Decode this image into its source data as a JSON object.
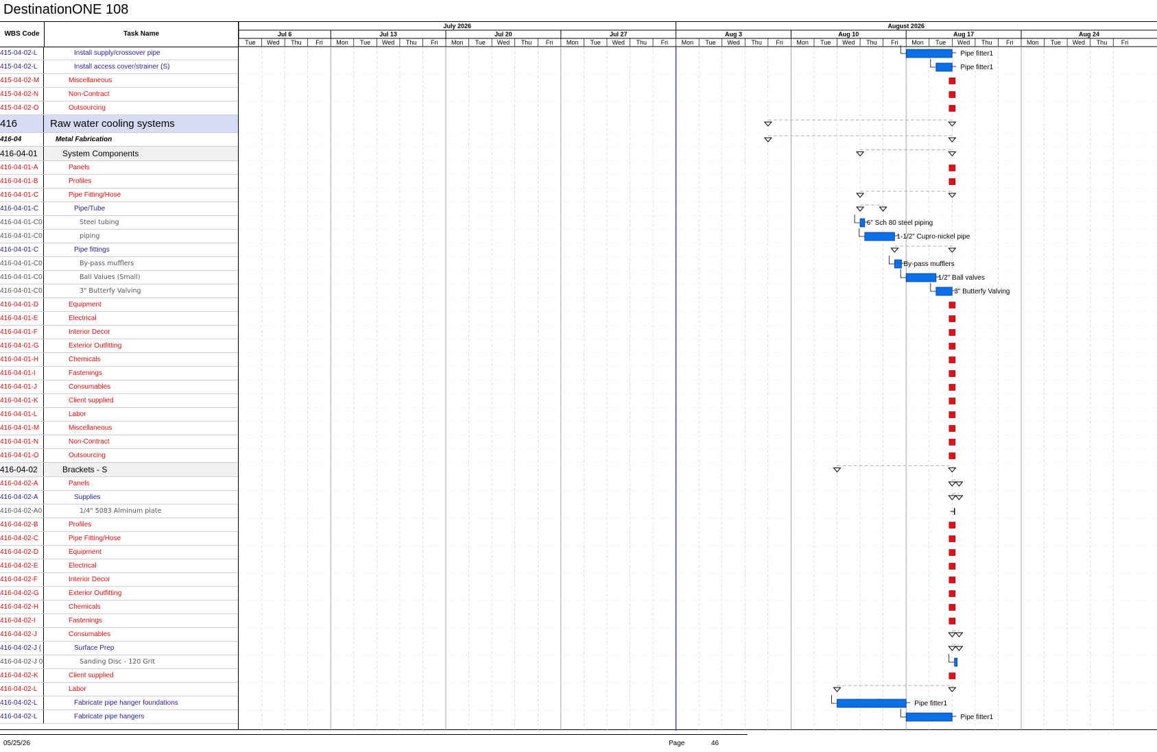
{
  "title": "DestinationONE 108",
  "headers": {
    "wbs": "WBS Code",
    "task": "Task Name"
  },
  "timescale": {
    "months": [
      {
        "label": "July 2026",
        "start": "2026-07-07",
        "end": "2026-08-03"
      },
      {
        "label": "August 2026",
        "start": "2026-08-03",
        "end": "2026-08-31"
      }
    ],
    "weeks": [
      {
        "label": "Jul 6",
        "start": "2026-07-07"
      },
      {
        "label": "Jul 13",
        "start": "2026-07-13"
      },
      {
        "label": "Jul 20",
        "start": "2026-07-20"
      },
      {
        "label": "Jul 27",
        "start": "2026-07-27"
      },
      {
        "label": "Aug 3",
        "start": "2026-08-03"
      },
      {
        "label": "Aug 10",
        "start": "2026-08-10"
      },
      {
        "label": "Aug 17",
        "start": "2026-08-17"
      },
      {
        "label": "Aug 24",
        "start": "2026-08-24"
      }
    ],
    "days": [
      "Tue",
      "Wed",
      "Thu",
      "Fri",
      "Mon",
      "Tue",
      "Wed",
      "Thu",
      "Fri",
      "Mon",
      "Tue",
      "Wed",
      "Thu",
      "Fri",
      "Mon",
      "Tue",
      "Wed",
      "Thu",
      "Fri",
      "Mon",
      "Tue",
      "Wed",
      "Thu",
      "Fri",
      "Mon",
      "Tue",
      "Wed",
      "Thu",
      "Fri",
      "Mon",
      "Tue",
      "Wed",
      "Thu",
      "Fri",
      "Mon",
      "Tue",
      "Wed",
      "Thu",
      "Fri"
    ]
  },
  "today_marker": "2026-08-03",
  "rows": [
    {
      "wbs": "415-04-02-L",
      "task": "Install supply/crossover pipe",
      "style": "blue",
      "indent": 2,
      "bar": {
        "start": "2026-08-17",
        "end": "2026-08-19",
        "label": "Pipe fitter1"
      }
    },
    {
      "wbs": "415-04-02-L",
      "task": "Install access cover/strainer (S)",
      "style": "blue",
      "indent": 2,
      "bar": {
        "start": "2026-08-18.3",
        "end": "2026-08-19",
        "label": "Pipe fitter1"
      }
    },
    {
      "wbs": "415-04-02-M",
      "task": "Miscellaneous",
      "style": "red",
      "indent": 1,
      "milestone": "2026-08-19"
    },
    {
      "wbs": "415-04-02-N",
      "task": "Non-Contract",
      "style": "red",
      "indent": 1,
      "milestone": "2026-08-19"
    },
    {
      "wbs": "415-04-02-O",
      "task": "Outsourcing",
      "style": "red",
      "indent": 1,
      "milestone": "2026-08-19"
    },
    {
      "wbs": "416",
      "task": "Raw water cooling systems",
      "style": "l1",
      "indent": 0,
      "summary": {
        "start": "2026-08-07",
        "end": "2026-08-19"
      }
    },
    {
      "wbs": "416-04",
      "task": "Metal Fabrication",
      "style": "l2",
      "indent": 0,
      "summary": {
        "start": "2026-08-07",
        "end": "2026-08-19"
      }
    },
    {
      "wbs": "416-04-01",
      "task": "System Components",
      "style": "l3",
      "indent": 0,
      "summary": {
        "start": "2026-08-13",
        "end": "2026-08-19"
      }
    },
    {
      "wbs": "416-04-01-A",
      "task": "Panels",
      "style": "red",
      "indent": 1,
      "milestone": "2026-08-19"
    },
    {
      "wbs": "416-04-01-B",
      "task": "Profiles",
      "style": "red",
      "indent": 1,
      "milestone": "2026-08-19"
    },
    {
      "wbs": "416-04-01-C",
      "task": "Pipe Fitting/Hose",
      "style": "red",
      "indent": 1,
      "summary": {
        "start": "2026-08-13",
        "end": "2026-08-19"
      }
    },
    {
      "wbs": "416-04-01-C",
      "task": "Pipe/Tube",
      "style": "blue",
      "indent": 2,
      "summary": {
        "start": "2026-08-13",
        "end": "2026-08-14"
      }
    },
    {
      "wbs": "416-04-01-C0",
      "task": "Steel tubing",
      "style": "gray",
      "indent": 3,
      "bar": {
        "start": "2026-08-13",
        "end": "2026-08-13.2",
        "label": "6\" Sch 80 steel piping"
      }
    },
    {
      "wbs": "416-04-01-C0",
      "task": "piping",
      "style": "gray",
      "indent": 3,
      "bar": {
        "start": "2026-08-13.2",
        "end": "2026-08-14.5",
        "label": "1-1/2\" Cupro-nickel pipe"
      }
    },
    {
      "wbs": "416-04-01-C",
      "task": "Pipe fittings",
      "style": "blue",
      "indent": 2,
      "summary": {
        "start": "2026-08-14.5",
        "end": "2026-08-19"
      }
    },
    {
      "wbs": "416-04-01-C0",
      "task": "By-pass mufflers",
      "style": "gray",
      "indent": 3,
      "bar": {
        "start": "2026-08-14.5",
        "end": "2026-08-14.8",
        "label": "By-pass mufflers"
      }
    },
    {
      "wbs": "416-04-01-C0",
      "task": "Ball Values (Small)",
      "style": "gray",
      "indent": 3,
      "bar": {
        "start": "2026-08-17",
        "end": "2026-08-18.3",
        "label": "1/2\" Ball valves"
      }
    },
    {
      "wbs": "416-04-01-C0",
      "task": "3\" Butterfy Valving",
      "style": "gray",
      "indent": 3,
      "bar": {
        "start": "2026-08-18.3",
        "end": "2026-08-19",
        "label": "3\" Butterfy Valving"
      }
    },
    {
      "wbs": "416-04-01-D",
      "task": "Equipment",
      "style": "red",
      "indent": 1,
      "milestone": "2026-08-19"
    },
    {
      "wbs": "416-04-01-E",
      "task": "Electrical",
      "style": "red",
      "indent": 1,
      "milestone": "2026-08-19"
    },
    {
      "wbs": "416-04-01-F",
      "task": "Interior Decor",
      "style": "red",
      "indent": 1,
      "milestone": "2026-08-19"
    },
    {
      "wbs": "416-04-01-G",
      "task": "Exterior Outfitting",
      "style": "red",
      "indent": 1,
      "milestone": "2026-08-19"
    },
    {
      "wbs": "416-04-01-H",
      "task": "Chemicals",
      "style": "red",
      "indent": 1,
      "milestone": "2026-08-19"
    },
    {
      "wbs": "416-04-01-I",
      "task": "Fastenings",
      "style": "red",
      "indent": 1,
      "milestone": "2026-08-19"
    },
    {
      "wbs": "416-04-01-J",
      "task": "Consumables",
      "style": "red",
      "indent": 1,
      "milestone": "2026-08-19"
    },
    {
      "wbs": "416-04-01-K",
      "task": "Client supplied",
      "style": "red",
      "indent": 1,
      "milestone": "2026-08-19"
    },
    {
      "wbs": "416-04-01-L",
      "task": "Labor",
      "style": "red",
      "indent": 1,
      "milestone": "2026-08-19"
    },
    {
      "wbs": "416-04-01-M",
      "task": "Miscellaneous",
      "style": "red",
      "indent": 1,
      "milestone": "2026-08-19"
    },
    {
      "wbs": "416-04-01-N",
      "task": "Non-Contract",
      "style": "red",
      "indent": 1,
      "milestone": "2026-08-19"
    },
    {
      "wbs": "416-04-01-O",
      "task": "Outsourcing",
      "style": "red",
      "indent": 1,
      "milestone": "2026-08-19"
    },
    {
      "wbs": "416-04-02",
      "task": "Brackets - S",
      "style": "l3",
      "indent": 0,
      "summary": {
        "start": "2026-08-12",
        "end": "2026-08-19"
      }
    },
    {
      "wbs": "416-04-02-A",
      "task": "Panels",
      "style": "red",
      "indent": 1,
      "summary": {
        "start": "2026-08-19",
        "end": "2026-08-19.3"
      }
    },
    {
      "wbs": "416-04-02-A",
      "task": "Supplies",
      "style": "blue",
      "indent": 2,
      "summary": {
        "start": "2026-08-19",
        "end": "2026-08-19.3"
      }
    },
    {
      "wbs": "416-04-02-A0",
      "task": "1/4\" 5083 Alminum plate",
      "style": "gray",
      "indent": 3,
      "tick": "2026-08-19.1"
    },
    {
      "wbs": "416-04-02-B",
      "task": "Profiles",
      "style": "red",
      "indent": 1,
      "milestone": "2026-08-19"
    },
    {
      "wbs": "416-04-02-C",
      "task": "Pipe Fitting/Hose",
      "style": "red",
      "indent": 1,
      "milestone": "2026-08-19"
    },
    {
      "wbs": "416-04-02-D",
      "task": "Equipment",
      "style": "red",
      "indent": 1,
      "milestone": "2026-08-19"
    },
    {
      "wbs": "416-04-02-E",
      "task": "Electrical",
      "style": "red",
      "indent": 1,
      "milestone": "2026-08-19"
    },
    {
      "wbs": "416-04-02-F",
      "task": "Interior Decor",
      "style": "red",
      "indent": 1,
      "milestone": "2026-08-19"
    },
    {
      "wbs": "416-04-02-G",
      "task": "Exterior Outfitting",
      "style": "red",
      "indent": 1,
      "milestone": "2026-08-19"
    },
    {
      "wbs": "416-04-02-H",
      "task": "Chemicals",
      "style": "red",
      "indent": 1,
      "milestone": "2026-08-19"
    },
    {
      "wbs": "416-04-02-I",
      "task": "Fastenings",
      "style": "red",
      "indent": 1,
      "milestone": "2026-08-19"
    },
    {
      "wbs": "416-04-02-J",
      "task": "Consumables",
      "style": "red",
      "indent": 1,
      "summary": {
        "start": "2026-08-19",
        "end": "2026-08-19.3"
      }
    },
    {
      "wbs": "416-04-02-J (",
      "task": "Surface Prep",
      "style": "blue",
      "indent": 2,
      "summary": {
        "start": "2026-08-19",
        "end": "2026-08-19.3"
      }
    },
    {
      "wbs": "416-04-02-J 0",
      "task": "Sanding Disc - 120 Grit",
      "style": "gray",
      "indent": 3,
      "bar": {
        "start": "2026-08-19.1",
        "end": "2026-08-19.2",
        "label": ""
      }
    },
    {
      "wbs": "416-04-02-K",
      "task": "Client supplied",
      "style": "red",
      "indent": 1,
      "milestone": "2026-08-19"
    },
    {
      "wbs": "416-04-02-L",
      "task": "Labor",
      "style": "red",
      "indent": 1,
      "summary": {
        "start": "2026-08-12",
        "end": "2026-08-19"
      }
    },
    {
      "wbs": "416-04-02-L",
      "task": "Fabricate pipe hanger foundations",
      "style": "blue",
      "indent": 2,
      "bar": {
        "start": "2026-08-12",
        "end": "2026-08-17",
        "label": "Pipe fitter1"
      }
    },
    {
      "wbs": "416-04-02-L",
      "task": "Fabricate pipe hangers",
      "style": "blue",
      "indent": 2,
      "bar": {
        "start": "2026-08-17",
        "end": "2026-08-19",
        "label": "Pipe fitter1"
      }
    }
  ],
  "footer": {
    "date": "05/25/26",
    "page_label": "Page",
    "page_number": "46"
  },
  "colors": {
    "red_text": "#e3100f",
    "blue_text": "#2b2296",
    "bar": "#0b6fe6",
    "milestone": "#e1101a",
    "today_line": "#3333cc",
    "l1_fill": "#d7dcf3"
  }
}
